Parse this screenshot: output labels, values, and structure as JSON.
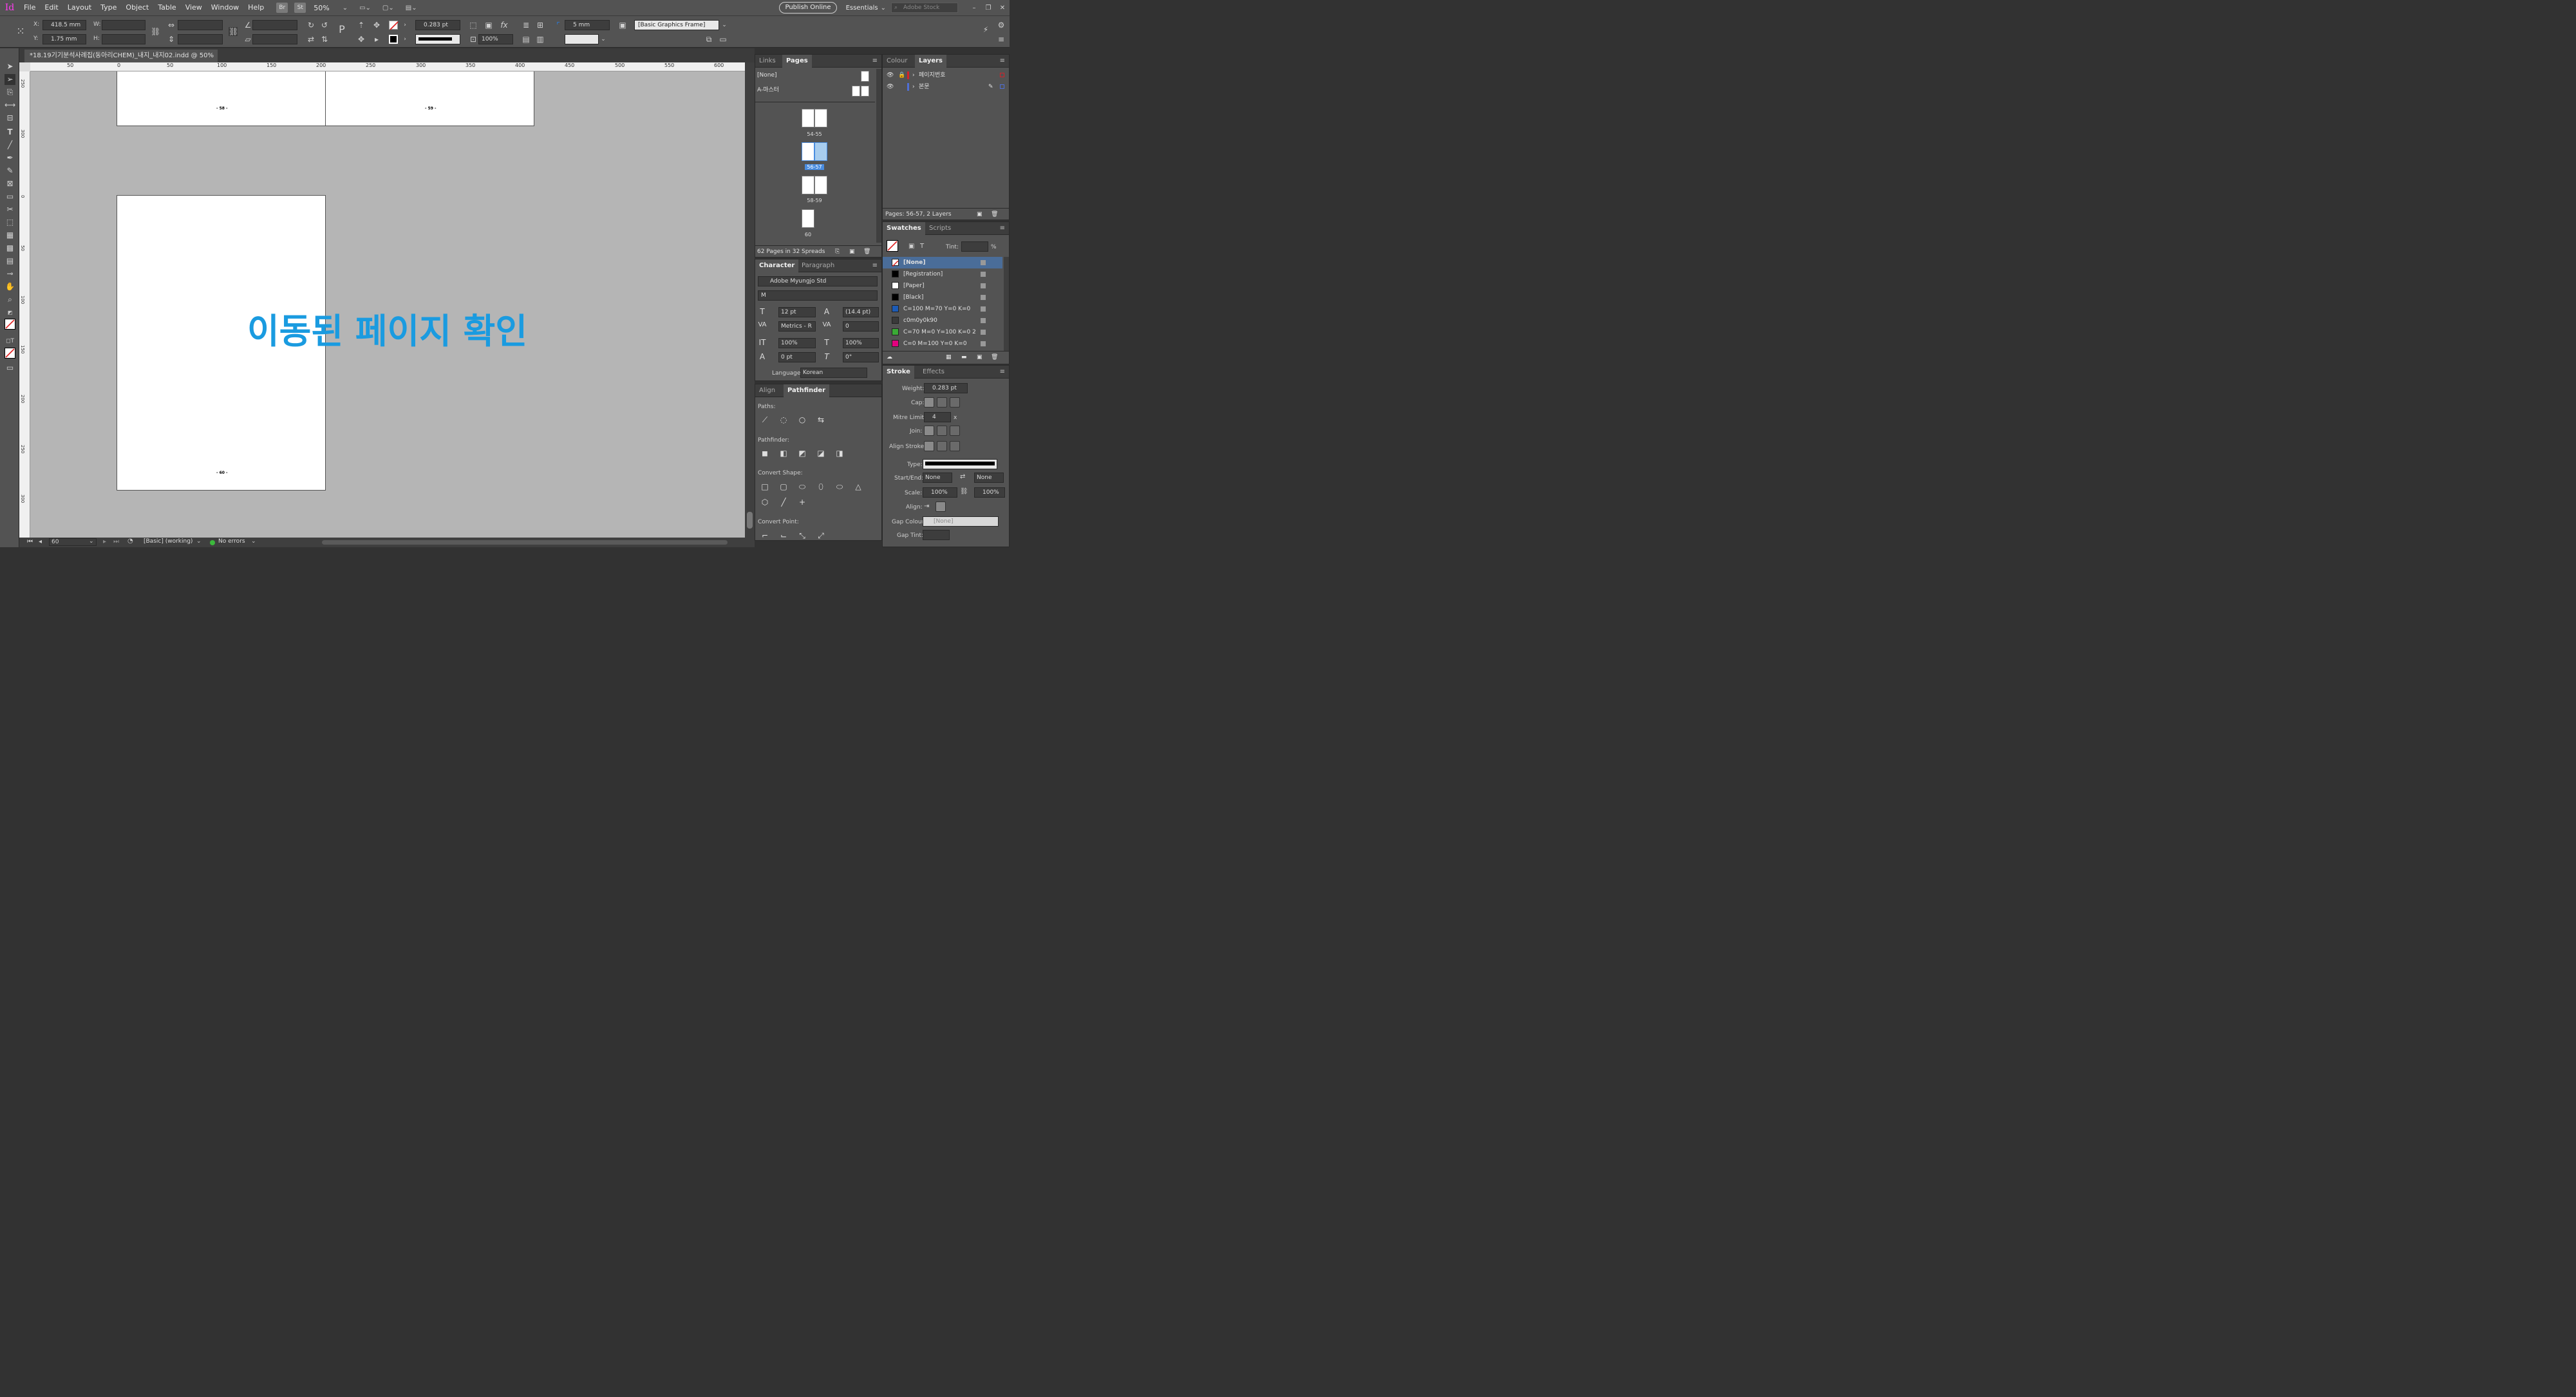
{
  "app": {
    "logo": "Id",
    "menu": [
      "File",
      "Edit",
      "Layout",
      "Type",
      "Object",
      "Table",
      "View",
      "Window",
      "Help"
    ],
    "bridge": "Br",
    "stock_btn": "St",
    "zoom": "50%",
    "publish": "Publish Online",
    "workspace": "Essentials",
    "search_placeholder": "Adobe Stock"
  },
  "control": {
    "x": "418.5 mm",
    "y": "1.75 mm",
    "x_label": "X:",
    "y_label": "Y:",
    "w_label": "W:",
    "h_label": "H:",
    "stroke_weight": "0.283 pt",
    "opacity": "100%",
    "offset": "5 mm",
    "object_style": "[Basic Graphics Frame]"
  },
  "document": {
    "tab_title": "*18.19기기분석사례집(동아리CHEM)_내지_내지02.indd @ 50%",
    "close": "×",
    "pages": [
      {
        "num": "- 58 -"
      },
      {
        "num": "- 59 -"
      },
      {
        "num": "- 60 -"
      }
    ],
    "overlay_text": "이동된 페이지 확인"
  },
  "ruler": {
    "h": [
      "50",
      "0",
      "50",
      "100",
      "150",
      "200",
      "250",
      "300",
      "350",
      "400",
      "450",
      "500",
      "550",
      "600"
    ],
    "v": [
      "250",
      "300",
      "0",
      "50",
      "100",
      "150",
      "200",
      "250",
      "300"
    ]
  },
  "status": {
    "page": "60",
    "preflight_profile": "[Basic] (working)",
    "errors": "No errors"
  },
  "pages_panel": {
    "tab_links": "Links",
    "tab_pages": "Pages",
    "none": "[None]",
    "master": "A-마스터",
    "spreads": [
      {
        "label": "54-55"
      },
      {
        "label": "56-57"
      },
      {
        "label": "58-59"
      },
      {
        "label": "60"
      }
    ],
    "footer": "62 Pages in 32 Spreads"
  },
  "character_panel": {
    "tab_character": "Character",
    "tab_paragraph": "Paragraph",
    "font": "Adobe Myungjo Std",
    "style": "M",
    "size": "12 pt",
    "leading": "(14.4 pt)",
    "kerning": "Metrics - R",
    "tracking": "0",
    "vscale": "100%",
    "hscale": "100%",
    "baseline": "0 pt",
    "skew": "0°",
    "language_label": "Language:",
    "language": "Korean"
  },
  "pathfinder_panel": {
    "tab_align": "Align",
    "tab_pathfinder": "Pathfinder",
    "paths": "Paths:",
    "pathfinder": "Pathfinder:",
    "convert_shape": "Convert Shape:",
    "convert_point": "Convert Point:"
  },
  "layers_panel": {
    "tab_colour": "Colour",
    "tab_layers": "Layers",
    "layers": [
      {
        "name": "페이지번호",
        "color": "#d2232a"
      },
      {
        "name": "본문",
        "color": "#4f6fd6"
      }
    ],
    "footer": "Pages: 56-57, 2 Layers"
  },
  "swatches_panel": {
    "tab_swatches": "Swatches",
    "tab_scripts": "Scripts",
    "tint_label": "Tint:",
    "tint_unit": "%",
    "swatches": [
      {
        "name": "[None]",
        "color": "#ffffff"
      },
      {
        "name": "[Registration]",
        "color": "#000000"
      },
      {
        "name": "[Paper]",
        "color": "#ffffff"
      },
      {
        "name": "[Black]",
        "color": "#000000"
      },
      {
        "name": "C=100 M=70 Y=0 K=0",
        "color": "#1d5bb5"
      },
      {
        "name": "c0m0y0k90",
        "color": "#3a3a3a"
      },
      {
        "name": "C=70 M=0 Y=100 K=0 2",
        "color": "#3aaa35"
      },
      {
        "name": "C=0 M=100 Y=0 K=0",
        "color": "#e4007f"
      }
    ]
  },
  "stroke_panel": {
    "tab_stroke": "Stroke",
    "tab_effects": "Effects",
    "weight_label": "Weight:",
    "weight": "0.283 pt",
    "cap_label": "Cap:",
    "mitre_label": "Mitre Limit:",
    "mitre": "4",
    "mitre_unit": "x",
    "join_label": "Join:",
    "align_stroke_label": "Align Stroke:",
    "type_label": "Type:",
    "startend_label": "Start/End:",
    "start": "None",
    "end": "None",
    "scale_label": "Scale:",
    "scale_start": "100%",
    "scale_end": "100%",
    "align_label": "Align:",
    "gap_colour_label": "Gap Colour:",
    "gap_colour": "[None]",
    "gap_tint_label": "Gap Tint:"
  }
}
